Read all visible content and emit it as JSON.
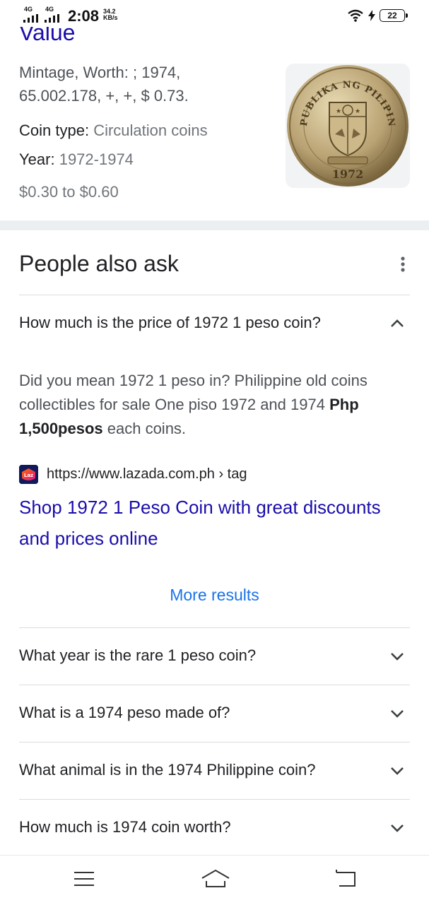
{
  "status_bar": {
    "network_1": "4G",
    "network_2": "4G",
    "time": "2:08",
    "speed_value": "34.2",
    "speed_unit": "KB/s",
    "battery": "22"
  },
  "value_card": {
    "heading_partial": "Value",
    "snippet": "Mintage, Worth: ; 1974, 65.002.178, +, +, $ 0.73.",
    "coin_type_label": "Coin type:",
    "coin_type_value": "Circulation coins",
    "year_label": "Year:",
    "year_value": "1972-1974",
    "price_range": "$0.30 to $0.60",
    "coin_image": {
      "inscription": "REPUBLIKA NG PILIPINAS",
      "year": "1972"
    }
  },
  "people_also_ask": {
    "title": "People also ask",
    "expanded": {
      "question": "How much is the price of 1972 1 peso coin?",
      "answer_pre": "Did you mean 1972 1 peso in? Philippine old coins collectibles for sale One piso 1972 and 1974 ",
      "answer_bold": "Php 1,500pesos",
      "answer_post": " each coins.",
      "source_url": "https://www.lazada.com.ph › tag",
      "favicon_text": "Laz",
      "result_title": "Shop 1972 1 Peso Coin with great discounts and prices online",
      "more_results": "More results"
    },
    "questions": [
      "What year is the rare 1 peso coin?",
      "What is a 1974 peso made of?",
      "What animal is in the 1974 Philippine coin?",
      "How much is 1974 coin worth?"
    ]
  },
  "colors": {
    "link": "#1a0dab",
    "more_results": "#1a73e8",
    "muted": "#70757a"
  }
}
